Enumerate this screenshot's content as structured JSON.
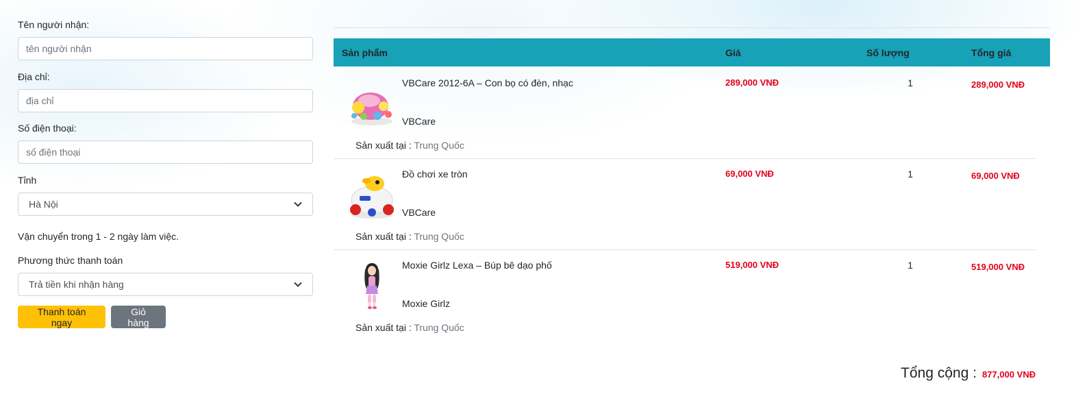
{
  "form": {
    "name_label": "Tên người nhận:",
    "name_placeholder": "tên người nhận",
    "address_label": "Địa chỉ:",
    "address_placeholder": "địa chỉ",
    "phone_label": "Số điện thoại:",
    "phone_placeholder": "số điện thoại",
    "province_label": "Tỉnh",
    "province_value": "Hà Nội",
    "shipping_note": "Vận chuyển trong 1 - 2 ngày làm việc.",
    "payment_label": "Phương thức thanh toán",
    "payment_value": "Trả tiền khi nhận hàng",
    "pay_button": "Thanh toán ngay",
    "cart_button": "Giỏ hàng"
  },
  "table": {
    "headers": [
      "Sản phẩm",
      "Giá",
      "Số lượng",
      "Tổng giá"
    ],
    "origin_label": "Sản xuất tại",
    "rows": [
      {
        "name": "VBCare 2012-6A – Con bọ có đèn, nhạc",
        "brand": "VBCare",
        "origin": "Trung Quốc",
        "price": "289,000 VNĐ",
        "qty": "1",
        "total": "289,000 VNĐ",
        "image_icon": "ladybug-toy-image"
      },
      {
        "name": "Đồ chơi xe tròn",
        "brand": "VBCare",
        "origin": "Trung Quốc",
        "price": "69,000 VNĐ",
        "qty": "1",
        "total": "69,000 VNĐ",
        "image_icon": "round-car-toy-image"
      },
      {
        "name": "Moxie Girlz Lexa – Búp bê dạo phố",
        "brand": "Moxie Girlz",
        "origin": "Trung Quốc",
        "price": "519,000 VNĐ",
        "qty": "1",
        "total": "519,000 VNĐ",
        "image_icon": "doll-image"
      }
    ]
  },
  "summary": {
    "total_label": "Tổng cộng :",
    "total_value": "877,000 VNĐ"
  },
  "colors": {
    "header_bg": "#17a2b8",
    "price": "#e3001b",
    "pay_button": "#ffc107",
    "cart_button": "#6c757d"
  }
}
